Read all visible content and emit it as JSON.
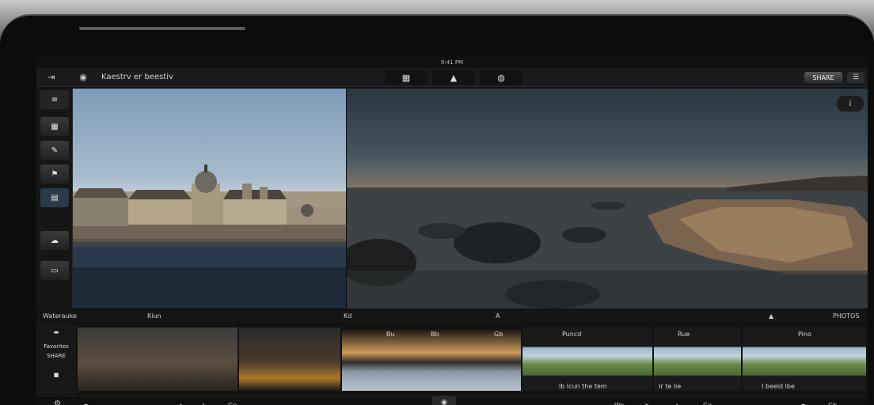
{
  "status_bar": {
    "time": "9:41 PM"
  },
  "toolbar": {
    "back_icon": "back-icon",
    "camera_icon": "camera-icon",
    "title": "Kaestrv er beestiv",
    "tools": [
      "crop-icon",
      "adjust-icon",
      "filter-icon"
    ],
    "share_label": "SHARE",
    "menu_icon": "menu-icon"
  },
  "left_rail": {
    "buttons": [
      "grid-icon",
      "album-icon",
      "edit-icon",
      "tag-icon",
      "layers-icon",
      "cloud-icon",
      "trash-icon"
    ]
  },
  "viewer": {
    "info_label": "i"
  },
  "filmstrip_labels": {
    "left": "Waterauke",
    "a": "Kiun",
    "b": "Kd",
    "c": "A",
    "right": "PHOTOS"
  },
  "filmstrip": {
    "side_top": "Favorites",
    "side_mid": "SHARE",
    "thumbs": [
      {
        "caption": ""
      },
      {
        "caption": ""
      },
      {
        "caption_1": "Bu",
        "caption_2": "Bb",
        "caption_3": "Gb"
      },
      {
        "caption": "Puncd",
        "caption_2": "lb lcun the tem"
      },
      {
        "caption": "Rue",
        "caption_2": "Ir te lie"
      },
      {
        "caption": "Pino",
        "caption_2": "I beeld lbe"
      }
    ]
  },
  "bottom_bar": {
    "left_icon": "gear-icon",
    "a": "Gp",
    "b": "Wo",
    "c": "Go",
    "d": "Go",
    "e": "Gb"
  },
  "colors": {
    "bezel": "#0c0c0c",
    "toolbar": "#1b1b1d",
    "accent": "#eaeaea"
  }
}
